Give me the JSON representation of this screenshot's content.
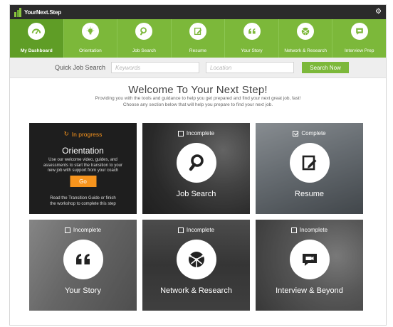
{
  "app": {
    "title": "YourNext.Step"
  },
  "nav": {
    "items": [
      {
        "label": "My Dashboard",
        "icon": "dashboard-gauge-icon",
        "active": true
      },
      {
        "label": "Orientation",
        "icon": "lightbulb-icon"
      },
      {
        "label": "Job Search",
        "icon": "magnifier-icon"
      },
      {
        "label": "Resume",
        "icon": "document-pen-icon"
      },
      {
        "label": "Your Story",
        "icon": "quote-icon"
      },
      {
        "label": "Network & Research",
        "icon": "network-globe-icon"
      },
      {
        "label": "Interview Prep",
        "icon": "video-chat-icon"
      }
    ]
  },
  "search": {
    "label": "Quick Job Search",
    "keywords_placeholder": "Keywords",
    "location_placeholder": "Location",
    "button": "Search Now"
  },
  "welcome": {
    "title": "Welcome To Your Next Step!",
    "line1": "Providing you with the tools and guidance to help you get prepared and find your next great job, fast!",
    "line2": "Choose any section below that will help you prepare to find your next job."
  },
  "tiles": {
    "orientation": {
      "status": "In progress",
      "title": "Orientation",
      "desc_line1": "Use our welcome video, guides, and",
      "desc_line2": "assessments to start the transition to your",
      "desc_line3": "new job with support from your coach",
      "button": "Go",
      "note_line1": "Read the Transition Guide or finish",
      "note_line2": "the workshop to complete this step"
    },
    "job_search": {
      "status": "Incomplete",
      "title": "Job Search",
      "complete": false
    },
    "resume": {
      "status": "Complete",
      "title": "Resume",
      "complete": true
    },
    "your_story": {
      "status": "Incomplete",
      "title": "Your Story",
      "complete": false
    },
    "network": {
      "status": "Incomplete",
      "title": "Network & Research",
      "complete": false
    },
    "interview": {
      "status": "Incomplete",
      "title": "Interview & Beyond",
      "complete": false
    }
  },
  "colors": {
    "brand_green": "#7cb83a",
    "active_green": "#5f9d26",
    "topbar": "#2b2b2b",
    "accent_orange": "#f7941d"
  }
}
